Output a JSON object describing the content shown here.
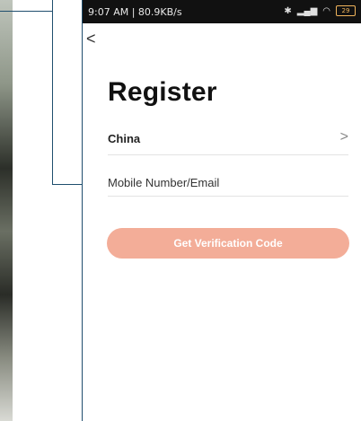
{
  "status_bar": {
    "time": "9:07 AM | 80.9KB/s",
    "alarm_icon": "alarm-icon",
    "bluetooth_icon": "bluetooth-icon",
    "signal_icon": "signal-icon",
    "wifi_icon": "wifi-icon",
    "battery_level": "29"
  },
  "header": {
    "back_icon": "chevron-left-icon",
    "back_label": "<"
  },
  "page": {
    "title": "Register"
  },
  "form": {
    "country": {
      "value": "China",
      "chevron": ">"
    },
    "account_field": {
      "value": "",
      "placeholder": "Mobile Number/Email"
    },
    "submit_label": "Get Verification Code"
  },
  "colors": {
    "accent": "#f3ad98",
    "status_bar": "#111111",
    "annotation": "#1f4e6e"
  }
}
